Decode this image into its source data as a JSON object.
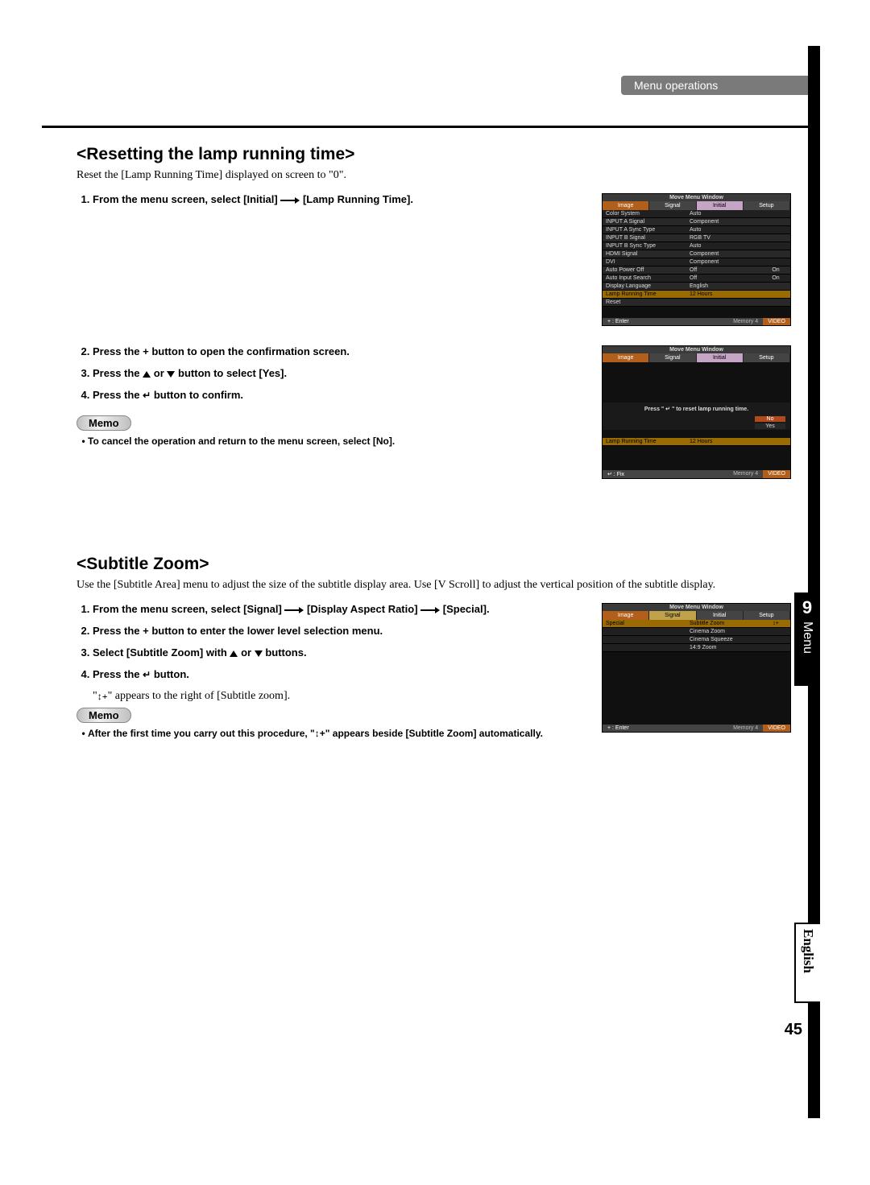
{
  "header": {
    "section_label": "Menu operations"
  },
  "side": {
    "chapter_number": "9",
    "chapter_title": "Menu",
    "language": "English"
  },
  "page_number": "45",
  "section1": {
    "heading": "<Resetting the lamp running time>",
    "intro": "Reset the [Lamp Running Time] displayed on screen to \"0\".",
    "steps": [
      {
        "pre": "From the menu screen, select [Initial] ",
        "post": " [Lamp Running Time]."
      },
      {
        "text": "Press the + button to open the confirmation screen."
      },
      {
        "pre": "Press the ",
        "mid": " or ",
        "post": " button to select [Yes]."
      },
      {
        "pre": "Press the ",
        "post": " button to confirm."
      }
    ],
    "memo_label": "Memo",
    "memo_items": [
      "To cancel the operation and return to the menu screen, select [No]."
    ]
  },
  "section2": {
    "heading": "<Subtitle Zoom>",
    "intro": "Use the [Subtitle Area] menu to adjust the size of the subtitle display area. Use [V Scroll] to adjust the vertical position of the subtitle display.",
    "steps": [
      {
        "pre": "From the menu screen, select [Signal] ",
        "mid": " [Display Aspect Ratio] ",
        "post": " [Special]."
      },
      {
        "text": "Press the + button to enter the lower level selection menu."
      },
      {
        "pre": "Select [Subtitle Zoom] with ",
        "mid": " or ",
        "post": " buttons."
      },
      {
        "pre": "Press the ",
        "post": " button."
      }
    ],
    "note_after_step4": "\" appears to the right of [Subtitle zoom].",
    "memo_label": "Memo",
    "memo_items": [
      "After the first time you carry out this procedure, \"↕+\" appears beside [Subtitle Zoom] automatically."
    ]
  },
  "osd": {
    "title": "Move Menu Window",
    "tabs": [
      "Image",
      "Signal",
      "Initial",
      "Setup"
    ],
    "panel1_rows": [
      {
        "label": "Color System",
        "val": "Auto"
      },
      {
        "label": "INPUT A Signal",
        "val": "Component"
      },
      {
        "label": "INPUT A Sync Type",
        "val": "Auto"
      },
      {
        "label": "INPUT B Signal",
        "val": "RGB TV"
      },
      {
        "label": "INPUT B Sync Type",
        "val": "Auto"
      },
      {
        "label": "HDMI Signal",
        "val": "Component"
      },
      {
        "label": "DVI",
        "val": "Component"
      },
      {
        "label": "Auto Power Off",
        "val": "Off",
        "opt": "On"
      },
      {
        "label": "Auto Input Search",
        "val": "Off",
        "opt": "On"
      },
      {
        "label": "Display Language",
        "val": "English"
      },
      {
        "label": "Lamp Running Time",
        "val": "12 Hours",
        "highlight": true
      },
      {
        "label": "Reset",
        "val": ""
      }
    ],
    "panel2_msg": "Press \" ↵ \" to reset lamp running time.",
    "panel2_no": "No",
    "panel2_yes": "Yes",
    "panel2_row": {
      "label": "Lamp Running Time",
      "val": "12 Hours"
    },
    "panel3_row_label": "Special",
    "panel3_items": [
      "Subtitle Zoom",
      "Cinema Zoom",
      "Cinema Squeeze",
      "14:9 Zoom"
    ],
    "footer_enter": "+ : Enter",
    "footer_fix": "↵ : Fix",
    "footer_memory": "Memory 4",
    "footer_source": "VIDEO"
  }
}
